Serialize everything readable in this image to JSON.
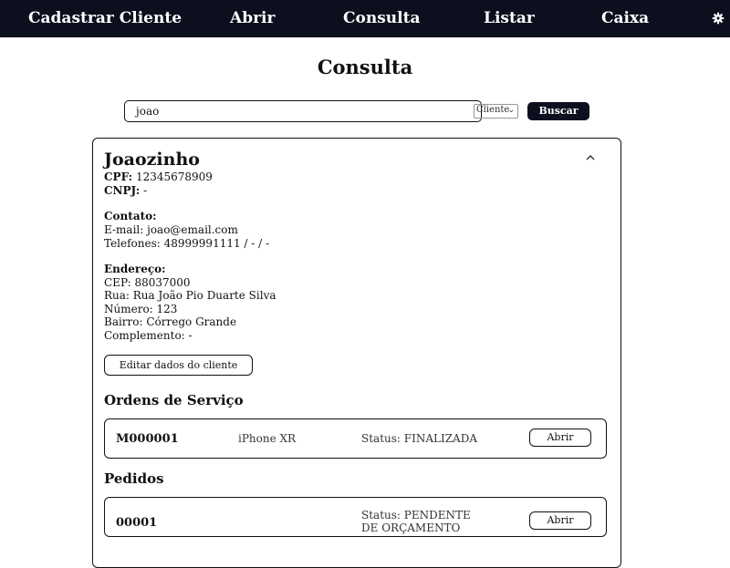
{
  "nav": {
    "items": [
      {
        "label": "Cadastrar Cliente"
      },
      {
        "label": "Abrir"
      },
      {
        "label": "Consulta"
      },
      {
        "label": "Listar"
      },
      {
        "label": "Caixa"
      }
    ],
    "settings_icon": "gear-icon"
  },
  "page": {
    "title": "Consulta"
  },
  "search": {
    "value": "joao",
    "type_selected": "Cliente",
    "button_label": "Buscar"
  },
  "client": {
    "name": "Joaozinho",
    "cpf_label": "CPF:",
    "cpf": "12345678909",
    "cnpj_label": "CNPJ:",
    "cnpj": "-",
    "contact_heading": "Contato:",
    "email_line": "E-mail: joao@email.com",
    "phone_line": "Telefones: 48999991111 / - / -",
    "address_heading": "Endereço:",
    "cep_line": "CEP: 88037000",
    "street_line": "Rua: Rua João Pio Duarte Silva",
    "number_line": "Número: 123",
    "district_line": "Bairro: Córrego Grande",
    "complement_line": "Complemento: -",
    "edit_button": "Editar dados do cliente"
  },
  "orders": {
    "title": "Ordens de Serviço",
    "items": [
      {
        "id": "M000001",
        "device": "iPhone XR",
        "status": "Status: FINALIZADA",
        "action": "Abrir"
      }
    ]
  },
  "requests": {
    "title": "Pedidos",
    "items": [
      {
        "id": "00001",
        "status": "Status: PENDENTE DE ORÇAMENTO",
        "action": "Abrir"
      }
    ]
  },
  "colors": {
    "navbar_bg": "#0b0f1e",
    "button_bg": "#0b0f1e",
    "text": "#111111"
  }
}
